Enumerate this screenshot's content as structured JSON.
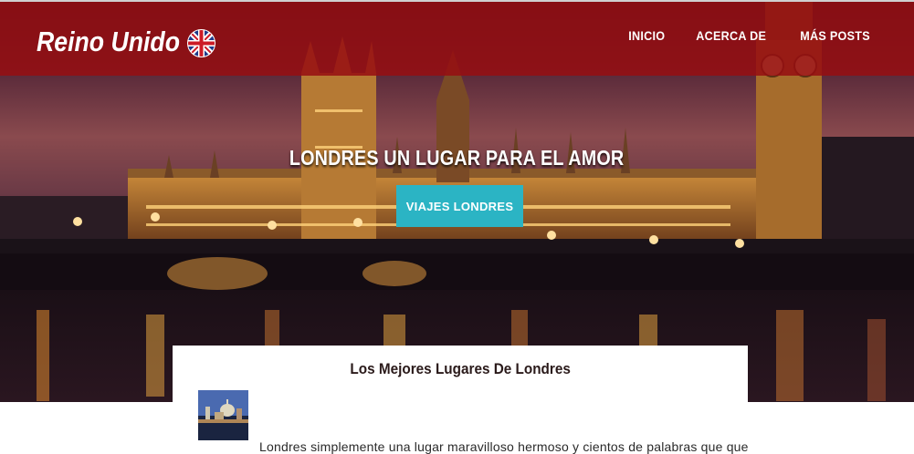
{
  "header": {
    "brand": "Reino Unido",
    "flag_icon": "uk-flag-icon",
    "nav": [
      {
        "label": "INICIO"
      },
      {
        "label": "ACERCA DE"
      },
      {
        "label": "MÁS POSTS"
      }
    ],
    "bar_color": "#960e12"
  },
  "hero": {
    "title": "LONDRES UN LUGAR PARA EL AMOR",
    "button_label": "VIAJES LONDRES",
    "button_color": "#2bb4c4"
  },
  "post": {
    "title": "Los Mejores Lugares De Londres",
    "excerpt": "Londres simplemente una lugar maravilloso hermoso y cientos de palabras que que"
  }
}
